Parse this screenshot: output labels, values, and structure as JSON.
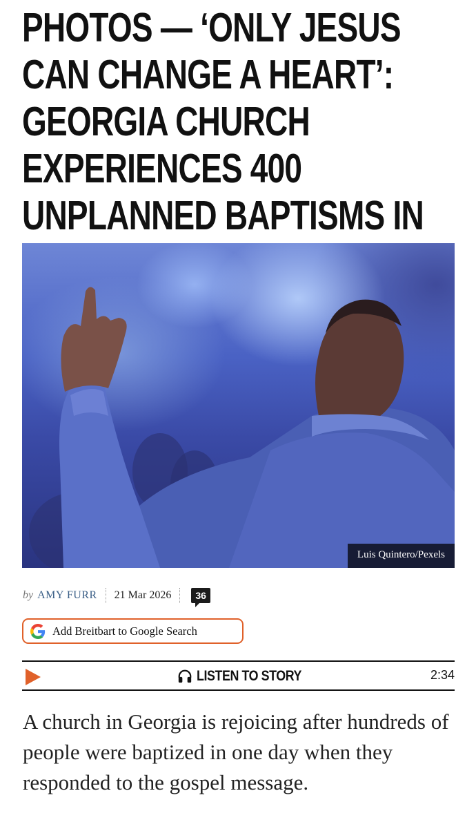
{
  "article": {
    "headline": "PHOTOS — ‘ONLY JESUS CAN CHANGE A HEART’: GEORGIA CHURCH EXPERIENCES 400 UNPLANNED BAPTISMS IN ONE DAY",
    "image_caption": "Luis Quintero/Pexels",
    "byline_prefix": "by",
    "author": "AMY FURR",
    "date": "21 Mar 2026",
    "comment_count": "36",
    "lede": "A church in Georgia is rejoicing after hundreds of people were baptized in one day when they responded to the gospel message."
  },
  "google_button": {
    "label": "Add Breitbart to Google Search",
    "icon": "google-icon"
  },
  "audio_player": {
    "label": "LISTEN TO STORY",
    "duration": "2:34",
    "play_icon": "play-icon",
    "headphones_icon": "headphones-icon"
  },
  "colors": {
    "accent": "#e0612a",
    "author_link": "#3b5f87",
    "text": "#111111"
  }
}
